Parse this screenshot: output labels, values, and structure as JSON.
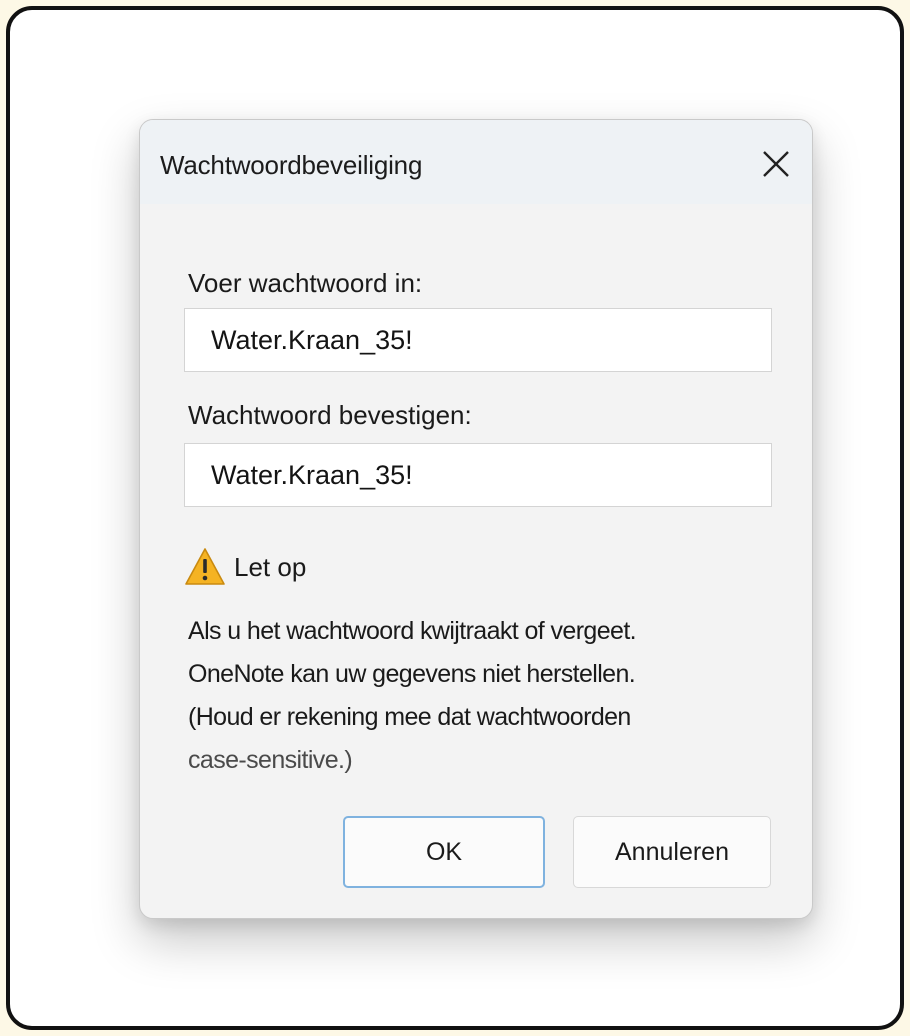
{
  "dialog": {
    "title": "Wachtwoordbeveiliging",
    "close_icon": "close-icon",
    "enter_label": "Voer wachtwoord in:",
    "enter_value": "Water.Kraan_35!",
    "confirm_label": "Wachtwoord bevestigen:",
    "confirm_value": "Water.Kraan_35!",
    "warning": {
      "icon": "warning-triangle-icon",
      "label": "Let op",
      "lines": [
        "Als u het wachtwoord kwijtraakt of vergeet.",
        "OneNote kan uw gegevens niet herstellen.",
        "(Houd er rekening mee dat wachtwoorden",
        "case-sensitive.)"
      ]
    },
    "ok_label": "OK",
    "cancel_label": "Annuleren"
  },
  "colors": {
    "titlebar": "#eef2f5",
    "dialog_bg": "#f3f3f3",
    "ok_border": "#7fb2df",
    "warning_fill": "#f5b323"
  }
}
